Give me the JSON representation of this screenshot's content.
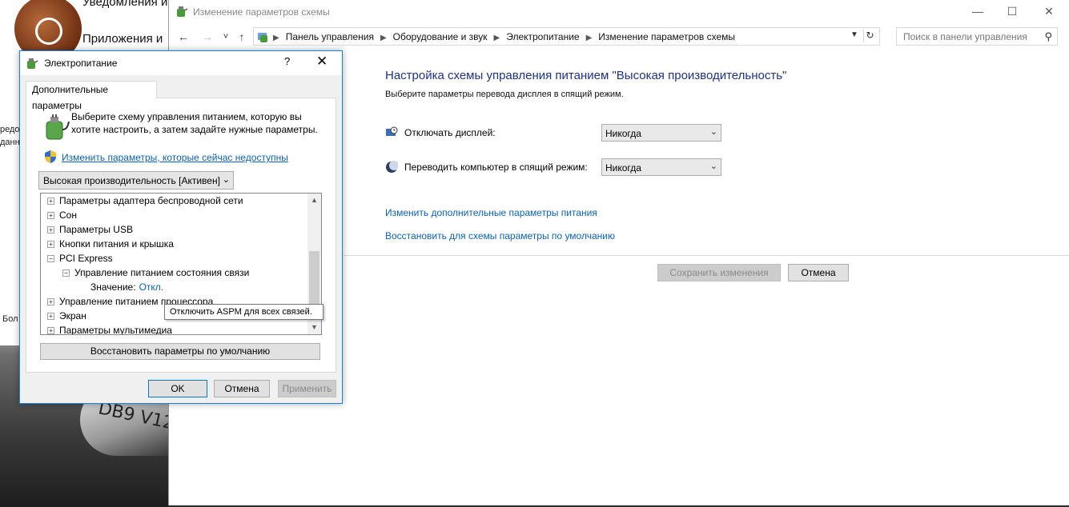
{
  "background": {
    "notifications_text": "Уведомления и",
    "apps_text": "Приложения и",
    "side_text_1": "редо",
    "side_text_2": "данн",
    "side_text_3": "Бол",
    "car_text": "DB9 V12"
  },
  "control_panel": {
    "window_title": "Изменение параметров схемы",
    "window_buttons": {
      "minimize": "—",
      "maximize": "☐",
      "close": "✕"
    },
    "nav": {
      "back": "←",
      "forward": "→",
      "up_history": "˅",
      "up": "↑"
    },
    "breadcrumbs": [
      "Панель управления",
      "Оборудование и звук",
      "Электропитание",
      "Изменение параметров схемы"
    ],
    "search_placeholder": "Поиск в панели управления",
    "heading": "Настройка схемы управления питанием \"Высокая производительность\"",
    "subheading": "Выберите параметры перевода дисплея в спящий режим.",
    "display_off": {
      "label": "Отключать дисплей:",
      "value": "Никогда"
    },
    "sleep": {
      "label": "Переводить компьютер в спящий режим:",
      "value": "Никогда"
    },
    "link_advanced": "Изменить дополнительные параметры питания",
    "link_restore": "Восстановить для схемы параметры по умолчанию",
    "save_button": "Сохранить изменения",
    "cancel_button": "Отмена"
  },
  "dialog": {
    "title": "Электропитание",
    "help": "?",
    "close": "✕",
    "tab": "Дополнительные параметры",
    "intro_text": "Выберите схему управления питанием, которую вы хотите настроить, а затем задайте нужные параметры.",
    "change_link": "Изменить параметры, которые сейчас недоступны",
    "scheme_value": "Высокая производительность [Активен]",
    "tree": [
      {
        "sign": "+",
        "label": "Параметры адаптера беспроводной сети"
      },
      {
        "sign": "+",
        "label": "Сон"
      },
      {
        "sign": "+",
        "label": "Параметры USB"
      },
      {
        "sign": "+",
        "label": "Кнопки питания и крышка"
      },
      {
        "sign": "−",
        "label": "PCI Express"
      },
      {
        "sign": "−",
        "label": "Управление питанием состояния связи"
      },
      {
        "value_label": "Значение:",
        "value": "Откл."
      },
      {
        "sign": "+",
        "label": "Управление питанием процессора"
      },
      {
        "sign": "+",
        "label": "Экран"
      },
      {
        "sign": "+",
        "label": "Параметры мультимедиа"
      }
    ],
    "tooltip": "Отключить ASPM для всех связей.",
    "restore_button": "Восстановить параметры по умолчанию",
    "ok_button": "OK",
    "cancel_button": "Отмена",
    "apply_button": "Применить"
  },
  "colors": {
    "link": "#0c62b5",
    "heading": "#1e3287",
    "dialog_border": "#1883d7"
  }
}
